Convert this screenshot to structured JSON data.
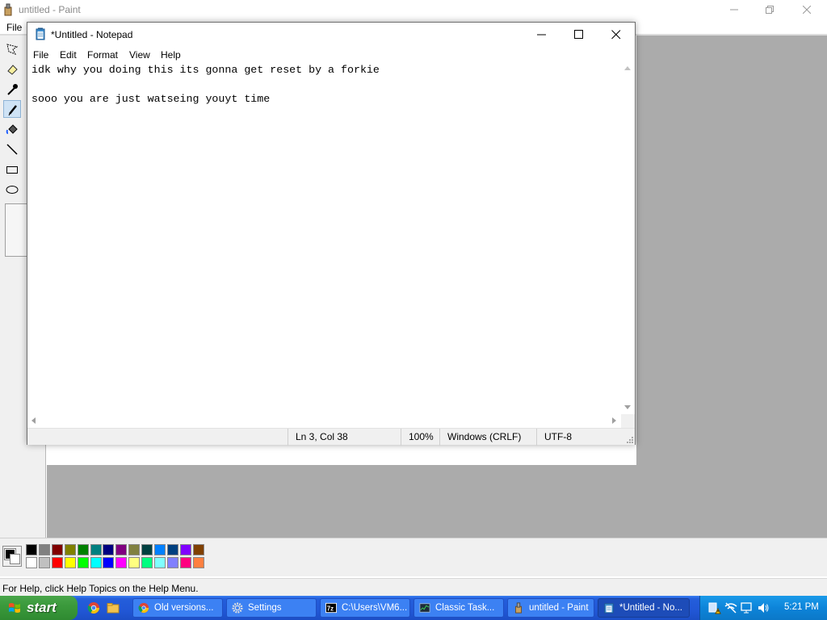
{
  "paint": {
    "title": "untitled - Paint",
    "menu": {
      "file": "File"
    },
    "status_text": "For Help, click Help Topics on the Help Menu.",
    "palette_top": [
      "#000000",
      "#808080",
      "#800000",
      "#808000",
      "#008000",
      "#008080",
      "#000080",
      "#800080",
      "#808040",
      "#004040",
      "#0080ff",
      "#004080",
      "#8000ff",
      "#804000"
    ],
    "palette_bottom": [
      "#ffffff",
      "#c0c0c0",
      "#ff0000",
      "#ffff00",
      "#00ff00",
      "#00ffff",
      "#0000ff",
      "#ff00ff",
      "#ffff80",
      "#00ff80",
      "#80ffff",
      "#8080ff",
      "#ff0080",
      "#ff8040"
    ],
    "colors": {
      "foreground": "#000000",
      "background": "#ffffff",
      "canvas_bg": "#ababab"
    }
  },
  "notepad": {
    "title": "*Untitled - Notepad",
    "menu": {
      "file": "File",
      "edit": "Edit",
      "format": "Format",
      "view": "View",
      "help": "Help"
    },
    "lines": [
      "idk why you doing this its gonna get reset by a forkie",
      "",
      "sooo you are just watseing youyt time"
    ],
    "status": {
      "position": "Ln 3, Col 38",
      "zoom": "100%",
      "line_ending": "Windows (CRLF)",
      "encoding": "UTF-8"
    }
  },
  "taskbar": {
    "start_label": "start",
    "buttons": [
      {
        "label": "Old versions...",
        "icon": "chrome-icon"
      },
      {
        "label": "Settings",
        "icon": "gear-icon"
      },
      {
        "label": "C:\\Users\\VM6...",
        "icon": "7zip-icon"
      },
      {
        "label": "Classic Task...",
        "icon": "task-manager-icon"
      },
      {
        "label": "untitled - Paint",
        "icon": "paint-icon"
      },
      {
        "label": "*Untitled - No...",
        "icon": "notepad-icon"
      }
    ],
    "clock": "5:21 PM"
  }
}
